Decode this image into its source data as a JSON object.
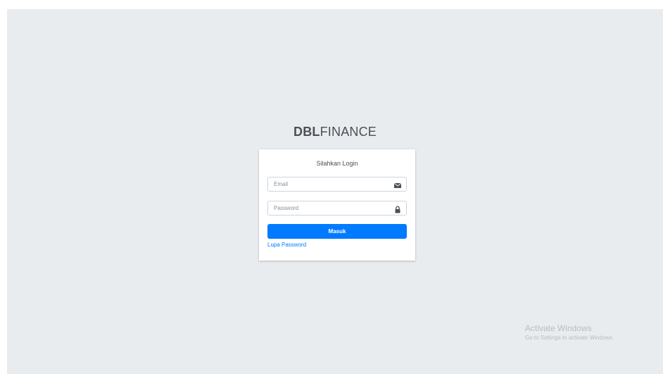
{
  "brand": {
    "bold": "DBL",
    "light": "FINANCE"
  },
  "login": {
    "title": "Silahkan Login",
    "email_placeholder": "Email",
    "email_icon": "envelope-icon",
    "password_placeholder": "Password",
    "password_icon": "lock-icon",
    "submit_label": "Masuk",
    "forgot_label": "Lupa Password"
  },
  "watermark": {
    "line1": "Activate Windows",
    "line2": "Go to Settings to activate Windows."
  },
  "colors": {
    "background": "#e9ecef",
    "primary": "#007bff"
  }
}
